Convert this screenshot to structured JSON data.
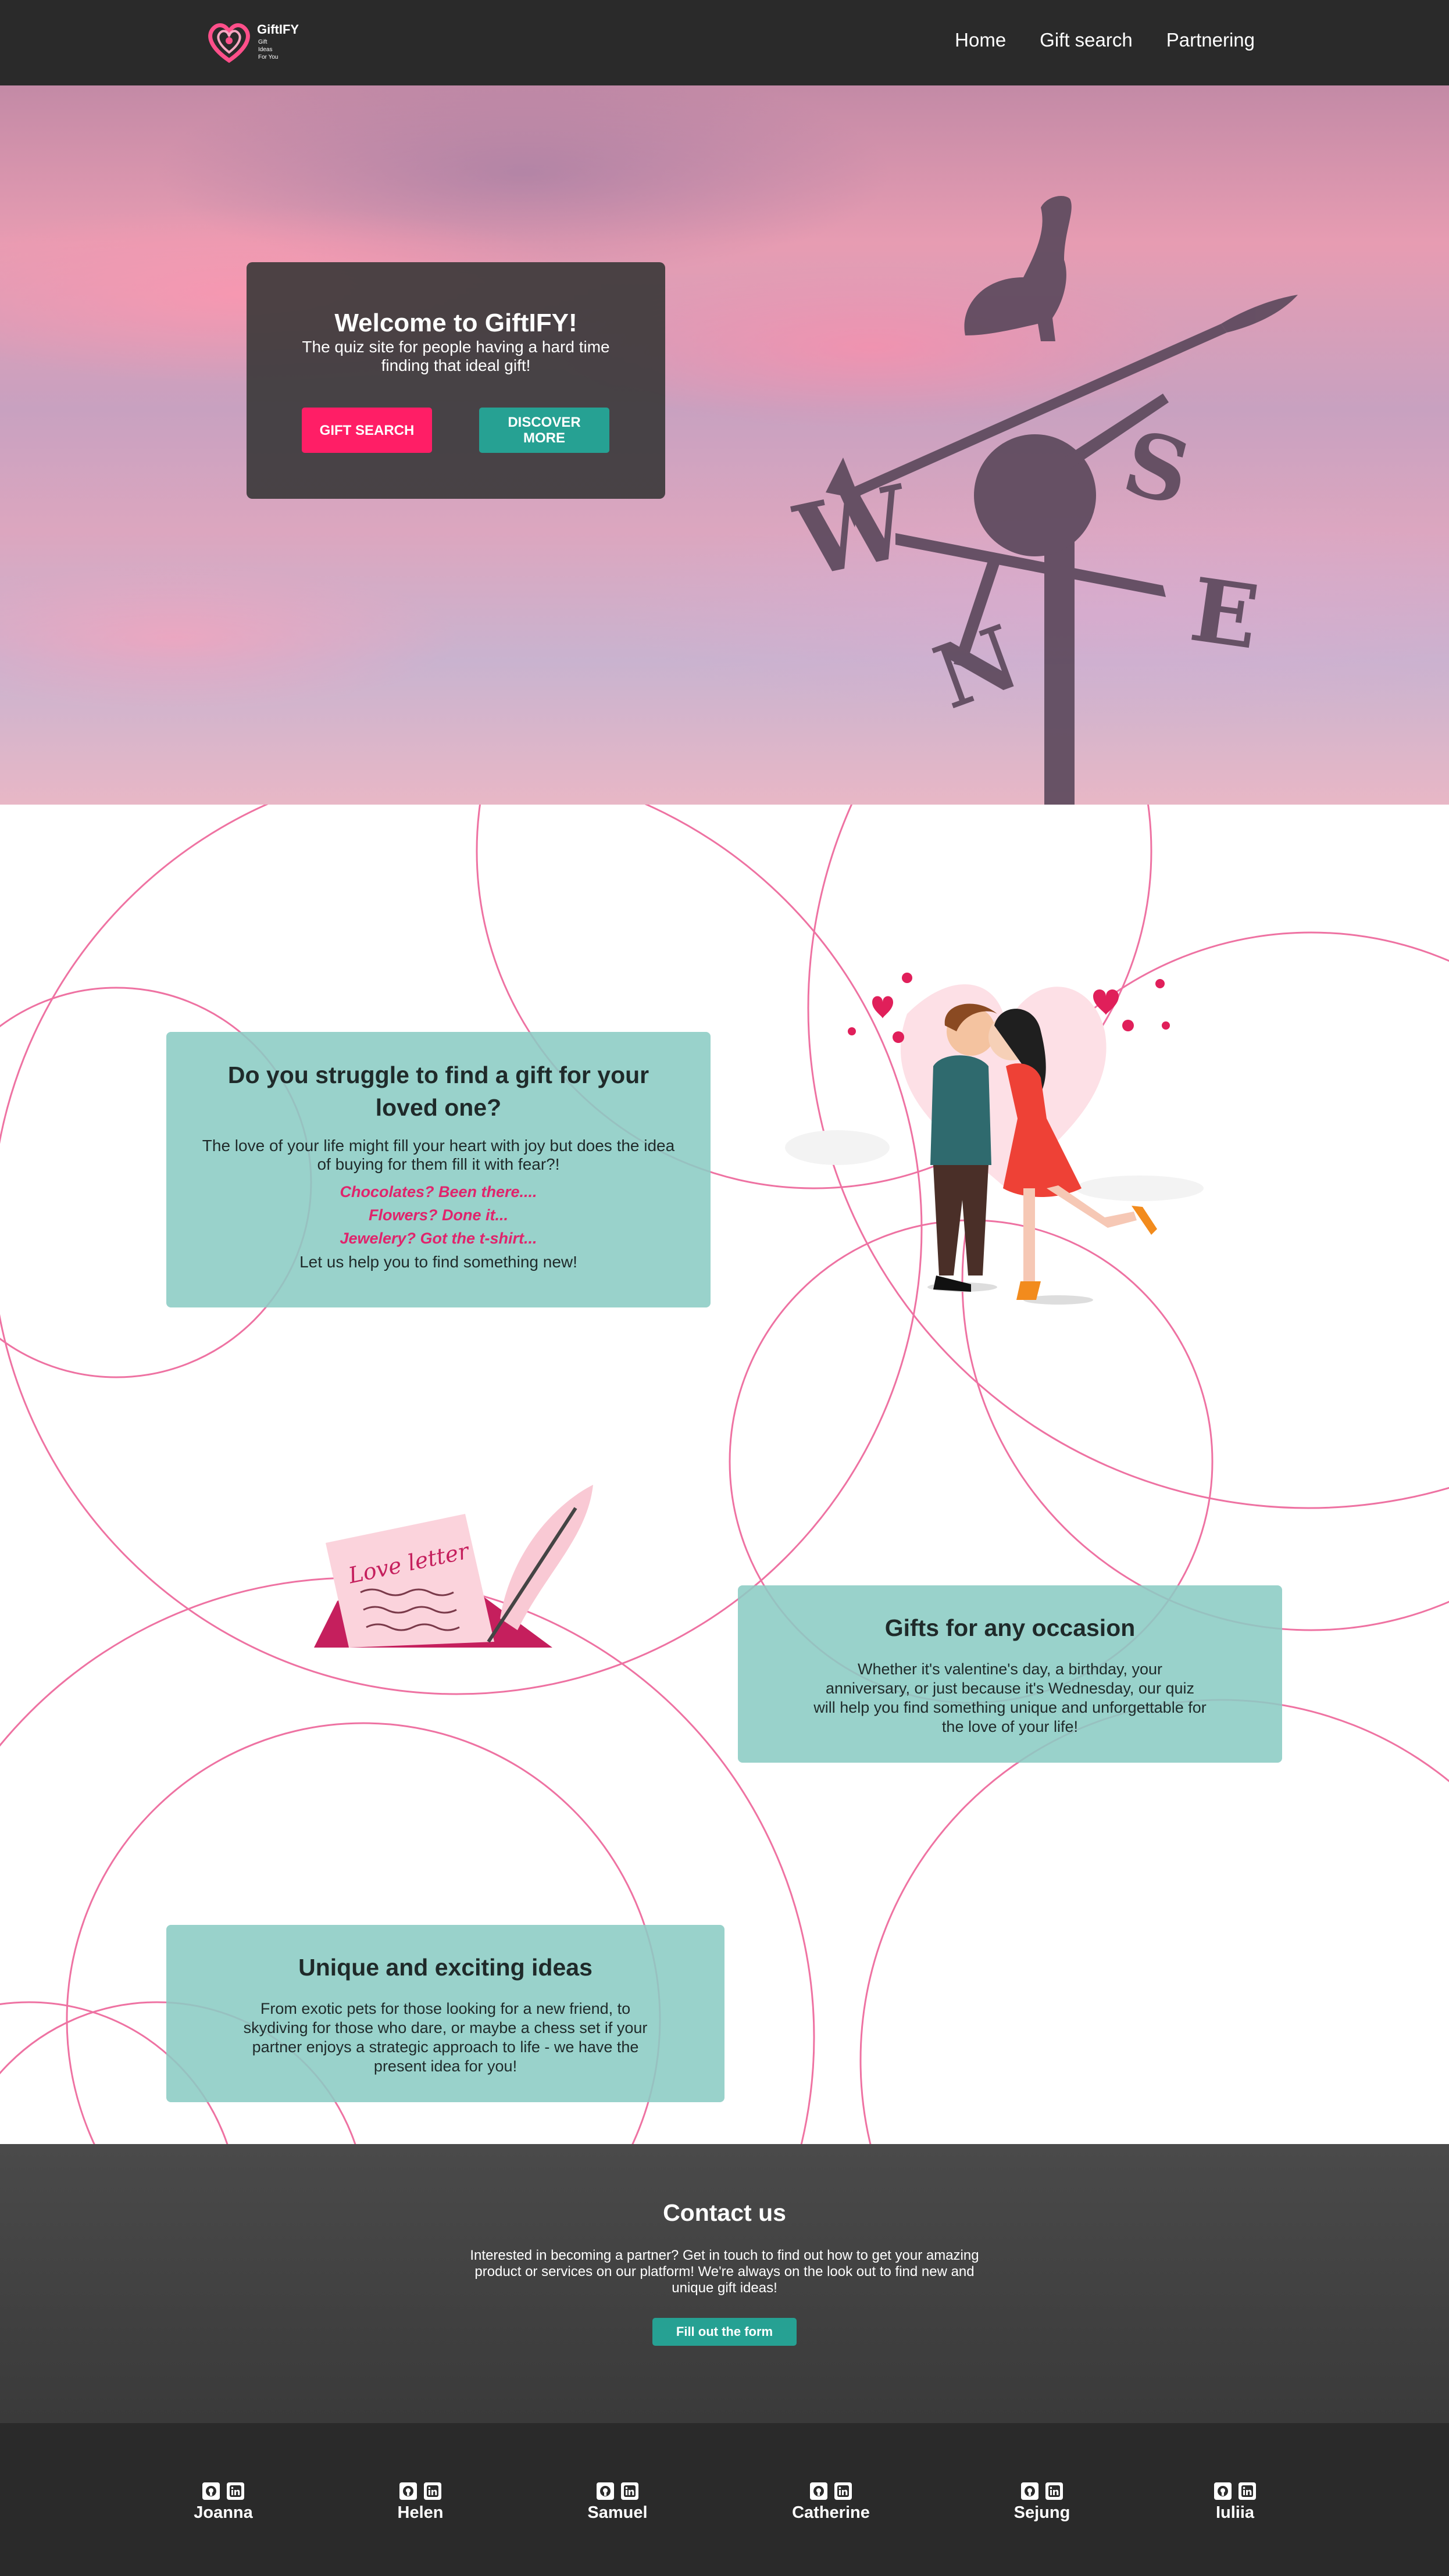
{
  "nav": {
    "logo": {
      "title": "GiftIFY",
      "line1": "Gift",
      "line2": "Ideas",
      "line3": "For You"
    },
    "links": [
      "Home",
      "Gift search",
      "Partnering"
    ]
  },
  "hero": {
    "title": "Welcome to GiftIFY!",
    "subtitle": "The quiz site for people having a hard time finding that ideal gift!",
    "gift_button": "GIFT SEARCH",
    "discover_button": "DISCOVER MORE"
  },
  "sections": {
    "struggle": {
      "title": "Do you struggle to find a gift for your loved one?",
      "body": "The love of your life might fill your heart with joy but does the idea of buying for them fill it with fear?!",
      "lines": [
        "Chocolates? Been there....",
        "Flowers? Done it...",
        "Jewelery? Got the t-shirt..."
      ],
      "closing": "Let us help you to find something new!"
    },
    "illustration": {
      "letter_text": "Love letter"
    },
    "occasion": {
      "title": "Gifts for any occasion",
      "body": "Whether it's valentine's day, a birthday, your anniversary, or just because it's Wednesday, our quiz will help you find something unique and unforgettable for the love of your life!"
    },
    "unique": {
      "title": "Unique and exciting ideas",
      "body": "From exotic pets for those looking for a new friend, to skydiving for those who dare, or maybe a chess set if your partner enjoys a strategic approach to life - we have the present idea for you!"
    }
  },
  "contact": {
    "title": "Contact us",
    "body": "Interested in becoming a partner? Get in touch to find out how to get your amazing product or services on our platform! We're always on the look out to find new and unique gift ideas!",
    "button": "Fill out the form"
  },
  "footer": {
    "members": [
      "Joanna",
      "Helen",
      "Samuel",
      "Catherine",
      "Sejung",
      "Iuliia"
    ],
    "icons": [
      "github-icon",
      "linkedin-icon"
    ]
  },
  "colors": {
    "accent_pink": "#ff1e66",
    "accent_teal": "#26a193",
    "card_teal": "#8bccc4",
    "dark": "#2a2a2a"
  }
}
